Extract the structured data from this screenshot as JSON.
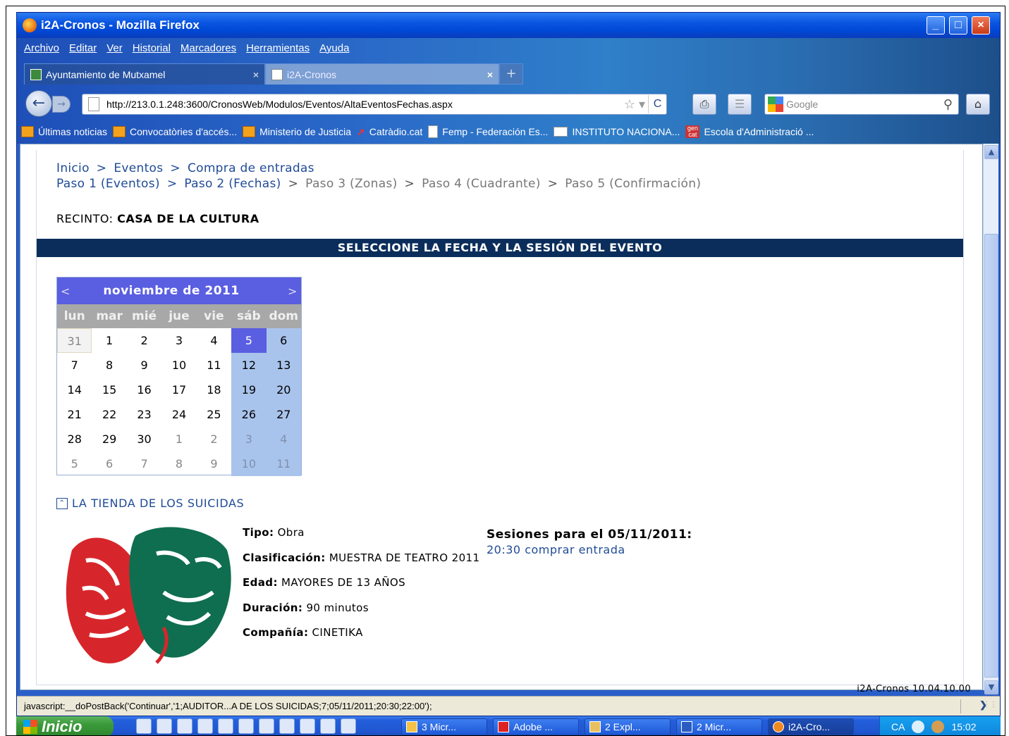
{
  "window": {
    "title": "i2A-Cronos - Mozilla Firefox",
    "buttons": {
      "minimize": "_",
      "maximize": "□",
      "close": "×"
    }
  },
  "menubar": [
    "Archivo",
    "Editar",
    "Ver",
    "Historial",
    "Marcadores",
    "Herramientas",
    "Ayuda"
  ],
  "tabs": [
    {
      "label": "Ayuntamiento de Mutxamel",
      "active": false
    },
    {
      "label": "i2A-Cronos",
      "active": true
    }
  ],
  "toolbar": {
    "url": "http://213.0.1.248:3600/CronosWeb/Modulos/Eventos/AltaEventosFechas.aspx",
    "search_placeholder": "Google"
  },
  "bookmarks": [
    {
      "label": "Últimas noticias",
      "icon": "rss-icon"
    },
    {
      "label": "Convocatòries d'accés...",
      "icon": "rss-icon"
    },
    {
      "label": "Ministerio de Justicia",
      "icon": "rss-icon"
    },
    {
      "label": "Catràdio.cat",
      "icon": "radio-icon"
    },
    {
      "label": "Femp - Federación Es...",
      "icon": "page-icon"
    },
    {
      "label": "INSTITUTO NACIONA...",
      "icon": "ine-icon"
    },
    {
      "label": "Escola d'Administració ...",
      "icon": "gencat-icon"
    }
  ],
  "breadcrumb": {
    "row1": [
      "Inicio",
      "Eventos",
      "Compra de entradas"
    ],
    "row1_sep": ">",
    "steps": [
      {
        "label": "Paso 1 (Eventos)",
        "enabled": true
      },
      {
        "label": "Paso 2 (Fechas)",
        "enabled": true
      },
      {
        "label": "Paso 3 (Zonas)",
        "enabled": false
      },
      {
        "label": "Paso 4 (Cuadrante)",
        "enabled": false
      },
      {
        "label": "Paso 5 (Confirmación)",
        "enabled": false
      }
    ]
  },
  "recinto": {
    "label": "RECINTO:",
    "value": "CASA DE LA CULTURA"
  },
  "section_title": "SELECCIONE LA FECHA Y LA SESIÓN DEL EVENTO",
  "calendar": {
    "prev": "<",
    "next": ">",
    "month": "noviembre de 2011",
    "weekdays": [
      "lun",
      "mar",
      "mié",
      "jue",
      "vie",
      "sáb",
      "dom"
    ],
    "weeks": [
      [
        "31",
        "1",
        "2",
        "3",
        "4",
        "5",
        "6"
      ],
      [
        "7",
        "8",
        "9",
        "10",
        "11",
        "12",
        "13"
      ],
      [
        "14",
        "15",
        "16",
        "17",
        "18",
        "19",
        "20"
      ],
      [
        "21",
        "22",
        "23",
        "24",
        "25",
        "26",
        "27"
      ],
      [
        "28",
        "29",
        "30",
        "1",
        "2",
        "3",
        "4"
      ],
      [
        "5",
        "6",
        "7",
        "8",
        "9",
        "10",
        "11"
      ]
    ],
    "selected": "5"
  },
  "event": {
    "title": "LA TIENDA DE LOS SUICIDAS",
    "fields": [
      {
        "label": "Tipo:",
        "value": "Obra"
      },
      {
        "label": "Clasificación:",
        "value": "MUESTRA DE TEATRO 2011"
      },
      {
        "label": "Edad:",
        "value": "MAYORES DE 13 AÑOS"
      },
      {
        "label": "Duración:",
        "value": "90 minutos"
      },
      {
        "label": "Compañía:",
        "value": "CINETIKA"
      }
    ],
    "sessions_title": "Sesiones para el 05/11/2011:",
    "sessions": [
      "20:30 comprar entrada"
    ]
  },
  "version": "i2A-Cronos 10.04.10.00",
  "statusbar": "javascript:__doPostBack('Continuar','1;AUDITOR...A DE LOS SUICIDAS;7;05/11/2011;20:30;22:00');",
  "taskbar": {
    "start": "Inicio",
    "tasks": [
      "3 Micr...",
      "Adobe ...",
      "2 Expl...",
      "2 Micr...",
      "i2A-Cro..."
    ],
    "lang": "CA",
    "clock": "15:02"
  },
  "colors": {
    "header_bar": "#0b2d5b",
    "calendar_header": "#5a5ee0",
    "weekend": "#a9c4ec",
    "link": "#1f4b96"
  }
}
